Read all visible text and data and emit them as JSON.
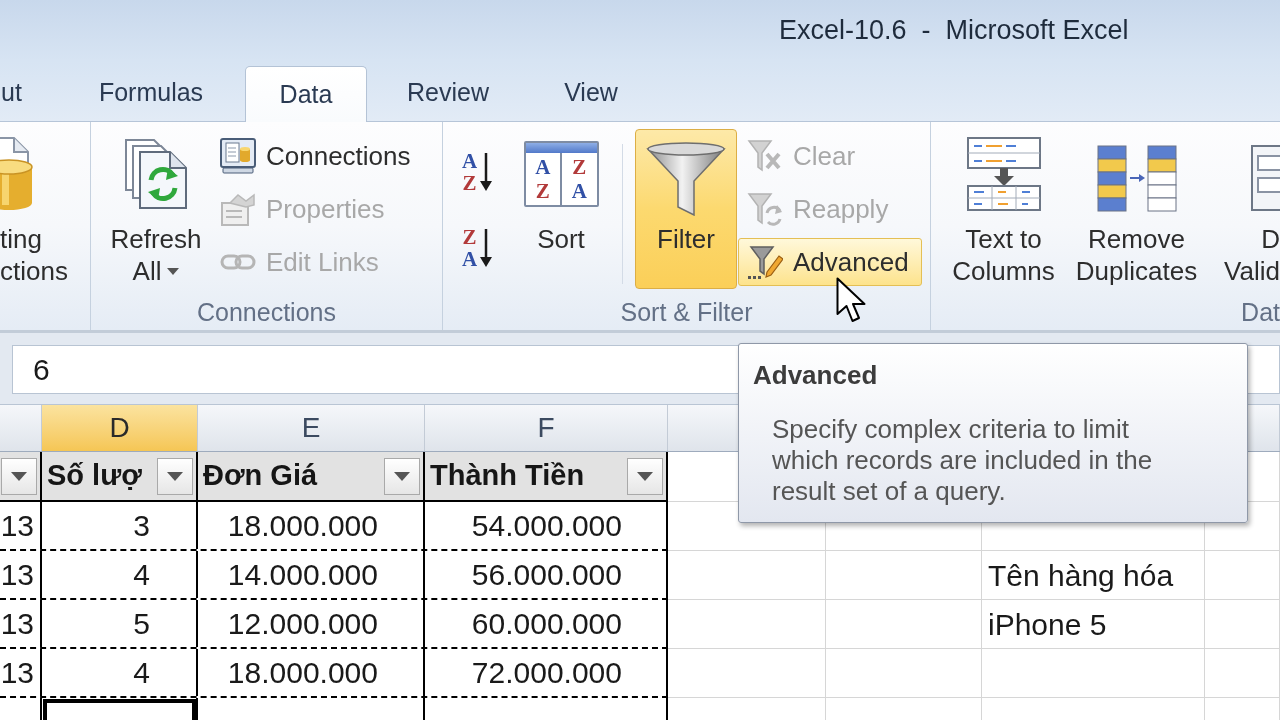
{
  "window": {
    "title": "Excel-10.6  -  Microsoft Excel"
  },
  "tabs": [
    {
      "label": "ut",
      "selected": false
    },
    {
      "label": "Formulas",
      "selected": false
    },
    {
      "label": "Data",
      "selected": true
    },
    {
      "label": "Review",
      "selected": false
    },
    {
      "label": "View",
      "selected": false
    }
  ],
  "ribbon": {
    "existing_connections": {
      "lines": [
        "ting",
        "ctions"
      ]
    },
    "connections_group": {
      "label": "Connections",
      "refresh_all": {
        "lines": [
          "Refresh",
          "All"
        ]
      },
      "buttons": [
        {
          "label": "Connections",
          "disabled": false
        },
        {
          "label": "Properties",
          "disabled": true
        },
        {
          "label": "Edit Links",
          "disabled": true
        }
      ]
    },
    "sort_filter_group": {
      "label": "Sort & Filter",
      "sort_ascending": {
        "letters": [
          "A",
          "Z"
        ]
      },
      "sort_descending": {
        "letters": [
          "Z",
          "A"
        ]
      },
      "sort": {
        "label": "Sort",
        "letters": [
          "A",
          "Z",
          "Z",
          "A"
        ]
      },
      "filter": {
        "label": "Filter",
        "selected": true
      },
      "buttons": [
        {
          "label": "Clear",
          "disabled": true,
          "highlighted": false
        },
        {
          "label": "Reapply",
          "disabled": true,
          "highlighted": false
        },
        {
          "label": "Advanced",
          "disabled": false,
          "highlighted": true
        }
      ]
    },
    "data_tools_group": {
      "label": "Dat",
      "text_to_columns": {
        "lines": [
          "Text to",
          "Columns"
        ]
      },
      "remove_duplicates": {
        "lines": [
          "Remove",
          "Duplicates"
        ]
      },
      "data_validation": {
        "lines": [
          "D",
          "Valid"
        ]
      }
    }
  },
  "formula_bar": {
    "value": "6"
  },
  "sheet": {
    "column_headers": [
      {
        "label": "D",
        "selected": true
      },
      {
        "label": "E",
        "selected": false
      },
      {
        "label": "F",
        "selected": false
      }
    ],
    "table_headers": [
      {
        "label": "Số lượ"
      },
      {
        "label": "Đơn Giá"
      },
      {
        "label": "Thành Tiền"
      }
    ],
    "rows": [
      {
        "cells": [
          "13",
          "3",
          "18.000.000",
          "54.000.000"
        ],
        "selected": false
      },
      {
        "cells": [
          "13",
          "4",
          "14.000.000",
          "56.000.000"
        ],
        "column_i": "Tên hàng hóa",
        "selected": false
      },
      {
        "cells": [
          "13",
          "5",
          "12.000.000",
          "60.000.000"
        ],
        "column_i": "iPhone 5",
        "selected": false
      },
      {
        "cells": [
          "13",
          "4",
          "18.000.000",
          "72.000.000"
        ],
        "selected": false
      },
      {
        "selected": true
      }
    ]
  },
  "tooltip": {
    "title": "Advanced",
    "description": "Specify complex criteria to limit which records are included in the result set of a query."
  }
}
